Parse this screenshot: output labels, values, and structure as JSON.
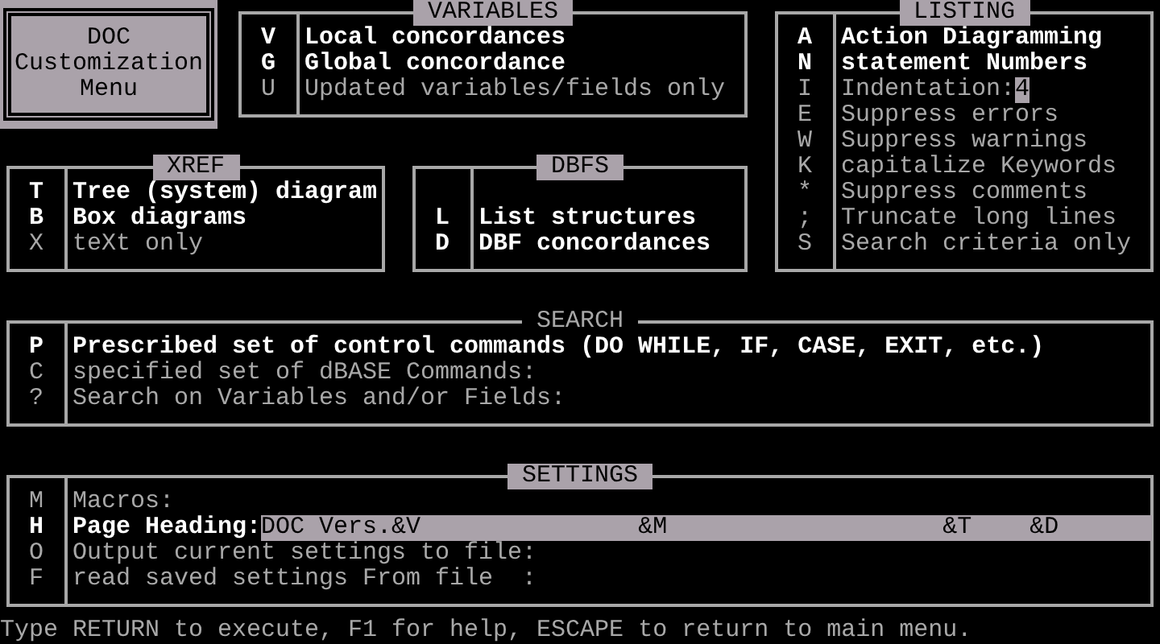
{
  "menu_box": {
    "lines": [
      "DOC",
      "Customization",
      "Menu"
    ]
  },
  "variables": {
    "title": "VARIABLES",
    "title_highlighted": true,
    "items": [
      {
        "kind": "option",
        "key": "V",
        "label": "Local concordances",
        "on": true
      },
      {
        "kind": "option",
        "key": "G",
        "label": "Global concordance",
        "on": true
      },
      {
        "kind": "option",
        "key": "U",
        "label": "Updated variables/fields only",
        "on": false
      }
    ]
  },
  "listing": {
    "title": "LISTING",
    "title_highlighted": true,
    "items": [
      {
        "kind": "option",
        "key": "A",
        "label": "Action Diagramming",
        "on": true
      },
      {
        "kind": "option",
        "key": "N",
        "label": "statement Numbers",
        "on": true
      },
      {
        "kind": "field",
        "key": "I",
        "label": "Indentation:",
        "value": "4",
        "on": false
      },
      {
        "kind": "option",
        "key": "E",
        "label": "Suppress errors",
        "on": false
      },
      {
        "kind": "option",
        "key": "W",
        "label": "Suppress warnings",
        "on": false
      },
      {
        "kind": "option",
        "key": "K",
        "label": "capitalize Keywords",
        "on": false
      },
      {
        "kind": "option",
        "key": "*",
        "label": "Suppress comments",
        "on": false
      },
      {
        "kind": "option",
        "key": ";",
        "label": "Truncate long lines",
        "on": false
      },
      {
        "kind": "option",
        "key": "S",
        "label": "Search criteria only",
        "on": false
      }
    ]
  },
  "xref": {
    "title": "XREF",
    "title_highlighted": true,
    "items": [
      {
        "kind": "option",
        "key": "T",
        "label": "Tree (system) diagram",
        "on": true
      },
      {
        "kind": "option",
        "key": "B",
        "label": "Box diagrams",
        "on": true
      },
      {
        "kind": "option",
        "key": "X",
        "label": "teXt only",
        "on": false
      }
    ]
  },
  "dbfs": {
    "title": "DBFS",
    "title_highlighted": true,
    "items": [
      {
        "kind": "option",
        "key": "L",
        "label": "List structures",
        "on": true
      },
      {
        "kind": "option",
        "key": "D",
        "label": "DBF concordances",
        "on": true
      }
    ]
  },
  "search": {
    "title": "SEARCH",
    "title_highlighted": false,
    "items": [
      {
        "kind": "option",
        "key": "P",
        "label": "Prescribed set of control commands (DO WHILE, IF, CASE, EXIT, etc.)",
        "on": true
      },
      {
        "kind": "option",
        "key": "C",
        "label": "specified set of dBASE Commands:",
        "on": false
      },
      {
        "kind": "option",
        "key": "?",
        "label": "Search on Variables and/or Fields:",
        "on": false
      }
    ]
  },
  "settings": {
    "title": "SETTINGS",
    "title_highlighted": true,
    "items": [
      {
        "kind": "option",
        "key": "M",
        "label": "Macros:",
        "on": false
      },
      {
        "kind": "field",
        "key": "H",
        "label": "Page Heading:",
        "value": "DOC Vers.&V               &M                   &T    &D",
        "on": true
      },
      {
        "kind": "option",
        "key": "O",
        "label": "Output current settings to file:",
        "on": false
      },
      {
        "kind": "option",
        "key": "F",
        "label": "read saved settings From file  :",
        "on": false
      }
    ]
  },
  "footer": "Type RETURN to execute, F1 for help, ESCAPE to return to main menu."
}
